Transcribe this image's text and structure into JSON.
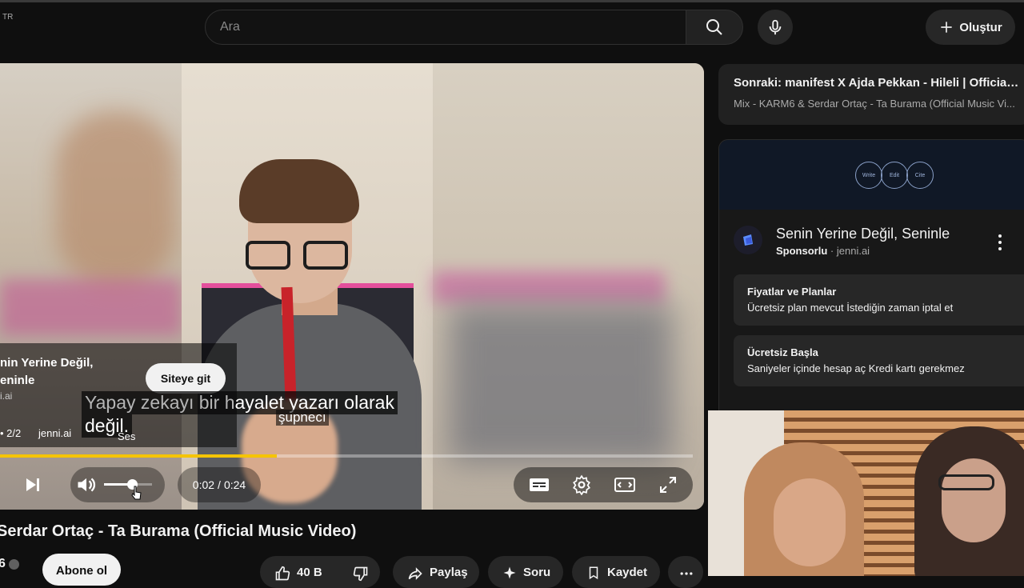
{
  "locale": "TR",
  "search": {
    "placeholder": "Ara"
  },
  "header": {
    "create_label": "Oluştur"
  },
  "player": {
    "ad": {
      "title": "nin Yerine Değil, eninle",
      "title_line1": "nin Yerine Değil,",
      "title_line2": "eninle",
      "site": "i.ai",
      "count": "• 2/2",
      "domain": "jenni.ai",
      "cta_label": "Siteye git"
    },
    "captions": {
      "line1_dim": "Yapay zekayı bir h",
      "line1": "ayalet yazarı olarak",
      "line2": "değil.",
      "small": "şupnecı"
    },
    "volume_tooltip": "Ses",
    "progress": 0.4,
    "volume_level": 0.55,
    "time_current": "0:02",
    "time_separator": "/",
    "time_total": "0:24"
  },
  "video": {
    "title": "Serdar Ortaç - Ta Burama (Official Music Video)",
    "channel_count_fragment": "6",
    "subscribe_label": "Abone ol",
    "like_count": "40 B",
    "share_label": "Paylaş",
    "ask_label": "Soru",
    "save_label": "Kaydet"
  },
  "up_next": {
    "title": "Sonraki: manifest X Ajda Pekkan - Hileli | Official ...",
    "subtitle": "Mix - KARM6 & Serdar Ortaç - Ta Burama (Official Music Vi..."
  },
  "sponsor": {
    "banner_logos": [
      "Write",
      "Edit",
      "Cite"
    ],
    "headline": "Senin Yerine Değil, Seninle",
    "sponsored_label": "Sponsorlu",
    "separator": "·",
    "domain": "jenni.ai",
    "features": [
      {
        "title": "Fiyatlar ve Planlar",
        "desc": "Ücretsiz plan mevcut İstediğin zaman iptal et"
      },
      {
        "title": "Ücretsiz Başla",
        "desc": "Saniyeler içinde hesap aç Kredi kartı gerekmez"
      }
    ]
  },
  "colors": {
    "accent": "#f5c400",
    "background": "#0f0f0f"
  }
}
